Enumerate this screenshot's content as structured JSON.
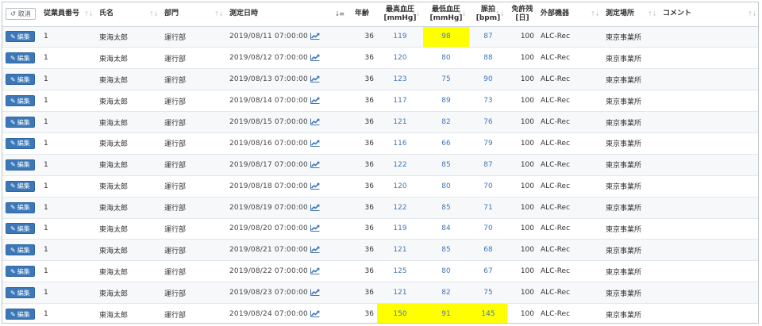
{
  "header": {
    "cancel_label": "取消",
    "employee_no": "従業員番号",
    "name": "氏名",
    "dept": "部門",
    "measured_at": "測定日時",
    "age": "年齢",
    "sys_label": "最高血圧",
    "sys_unit": "[mmHg]",
    "dia_label": "最低血圧",
    "dia_unit": "[mmHg]",
    "pulse_label": "脈拍",
    "pulse_unit": "[bpm]",
    "exempt_label": "免許残",
    "exempt_unit": "[日]",
    "device": "外部機器",
    "location": "測定場所",
    "comment": "コメント"
  },
  "edit_label": "編集",
  "rows": [
    {
      "emp": "1",
      "name": "東海太郎",
      "dept": "運行部",
      "datetime": "2019/08/11 07:00:00",
      "age": "36",
      "sys": "119",
      "dia": "98",
      "pulse": "87",
      "exempt": "100",
      "device": "ALC-Rec",
      "location": "東京事業所",
      "comment": ""
    },
    {
      "emp": "1",
      "name": "東海太郎",
      "dept": "運行部",
      "datetime": "2019/08/12 07:00:00",
      "age": "36",
      "sys": "120",
      "dia": "80",
      "pulse": "88",
      "exempt": "100",
      "device": "ALC-Rec",
      "location": "東京事業所",
      "comment": ""
    },
    {
      "emp": "1",
      "name": "東海太郎",
      "dept": "運行部",
      "datetime": "2019/08/13 07:00:00",
      "age": "36",
      "sys": "123",
      "dia": "75",
      "pulse": "90",
      "exempt": "100",
      "device": "ALC-Rec",
      "location": "東京事業所",
      "comment": ""
    },
    {
      "emp": "1",
      "name": "東海太郎",
      "dept": "運行部",
      "datetime": "2019/08/14 07:00:00",
      "age": "36",
      "sys": "117",
      "dia": "89",
      "pulse": "73",
      "exempt": "100",
      "device": "ALC-Rec",
      "location": "東京事業所",
      "comment": ""
    },
    {
      "emp": "1",
      "name": "東海太郎",
      "dept": "運行部",
      "datetime": "2019/08/15 07:00:00",
      "age": "36",
      "sys": "121",
      "dia": "82",
      "pulse": "76",
      "exempt": "100",
      "device": "ALC-Rec",
      "location": "東京事業所",
      "comment": ""
    },
    {
      "emp": "1",
      "name": "東海太郎",
      "dept": "運行部",
      "datetime": "2019/08/16 07:00:00",
      "age": "36",
      "sys": "116",
      "dia": "66",
      "pulse": "79",
      "exempt": "100",
      "device": "ALC-Rec",
      "location": "東京事業所",
      "comment": ""
    },
    {
      "emp": "1",
      "name": "東海太郎",
      "dept": "運行部",
      "datetime": "2019/08/17 07:00:00",
      "age": "36",
      "sys": "122",
      "dia": "85",
      "pulse": "87",
      "exempt": "100",
      "device": "ALC-Rec",
      "location": "東京事業所",
      "comment": ""
    },
    {
      "emp": "1",
      "name": "東海太郎",
      "dept": "運行部",
      "datetime": "2019/08/18 07:00:00",
      "age": "36",
      "sys": "120",
      "dia": "80",
      "pulse": "70",
      "exempt": "100",
      "device": "ALC-Rec",
      "location": "東京事業所",
      "comment": ""
    },
    {
      "emp": "1",
      "name": "東海太郎",
      "dept": "運行部",
      "datetime": "2019/08/19 07:00:00",
      "age": "36",
      "sys": "122",
      "dia": "85",
      "pulse": "71",
      "exempt": "100",
      "device": "ALC-Rec",
      "location": "東京事業所",
      "comment": ""
    },
    {
      "emp": "1",
      "name": "東海太郎",
      "dept": "運行部",
      "datetime": "2019/08/20 07:00:00",
      "age": "36",
      "sys": "119",
      "dia": "84",
      "pulse": "70",
      "exempt": "100",
      "device": "ALC-Rec",
      "location": "東京事業所",
      "comment": ""
    },
    {
      "emp": "1",
      "name": "東海太郎",
      "dept": "運行部",
      "datetime": "2019/08/21 07:00:00",
      "age": "36",
      "sys": "121",
      "dia": "85",
      "pulse": "68",
      "exempt": "100",
      "device": "ALC-Rec",
      "location": "東京事業所",
      "comment": ""
    },
    {
      "emp": "1",
      "name": "東海太郎",
      "dept": "運行部",
      "datetime": "2019/08/22 07:00:00",
      "age": "36",
      "sys": "125",
      "dia": "80",
      "pulse": "67",
      "exempt": "100",
      "device": "ALC-Rec",
      "location": "東京事業所",
      "comment": ""
    },
    {
      "emp": "1",
      "name": "東海太郎",
      "dept": "運行部",
      "datetime": "2019/08/23 07:00:00",
      "age": "36",
      "sys": "121",
      "dia": "82",
      "pulse": "75",
      "exempt": "100",
      "device": "ALC-Rec",
      "location": "東京事業所",
      "comment": ""
    },
    {
      "emp": "1",
      "name": "東海太郎",
      "dept": "運行部",
      "datetime": "2019/08/24 07:00:00",
      "age": "36",
      "sys": "150",
      "dia": "91",
      "pulse": "145",
      "exempt": "100",
      "device": "ALC-Rec",
      "location": "東京事業所",
      "comment": ""
    }
  ],
  "highlights": [
    {
      "row": 0,
      "field": "dia"
    },
    {
      "row": 13,
      "field": "sys"
    },
    {
      "row": 13,
      "field": "dia"
    },
    {
      "row": 13,
      "field": "pulse"
    }
  ],
  "colors": {
    "highlight": "#ffff00",
    "button": "#3c78b8",
    "value_link": "#3f77b8",
    "trend_icon": "#3f77b8"
  },
  "icons": {
    "cancel": "undo-icon",
    "edit": "edit-icon",
    "trend": "line-chart-icon",
    "sort": "sort-icon"
  }
}
